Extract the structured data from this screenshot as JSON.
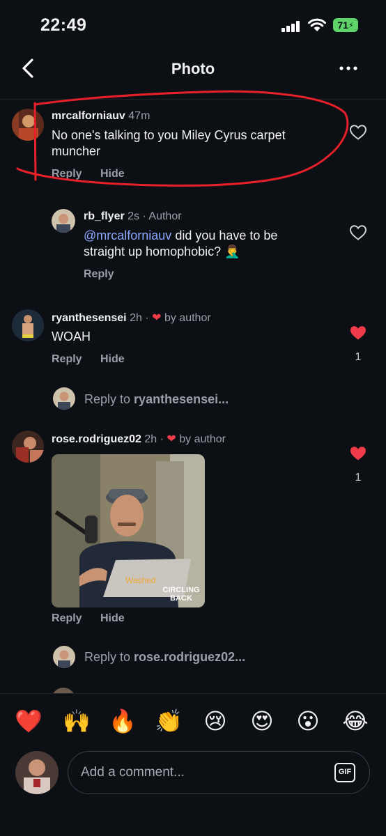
{
  "status_bar": {
    "time": "22:49",
    "battery": "71"
  },
  "nav": {
    "title": "Photo"
  },
  "comments": [
    {
      "username": "mrcalforniauv",
      "time": "47m",
      "text": "No one's talking to you Miley Cyrus carpet muncher",
      "reply_label": "Reply",
      "hide_label": "Hide"
    },
    {
      "username": "rb_flyer",
      "time": "2s",
      "author_tag": "· Author",
      "mention": "@mrcalforniauv",
      "text": " did you have to be straight up homophobic? 🤦‍♂️",
      "reply_label": "Reply"
    },
    {
      "username": "ryanthesensei",
      "time": "2h ·",
      "liked_by": "by author",
      "text": "WOAH",
      "reply_label": "Reply",
      "hide_label": "Hide",
      "like_count": "1",
      "reply_to_prefix": "Reply to ",
      "reply_to_user": "ryanthesensei..."
    },
    {
      "username": "rose.rodriguez02",
      "time": "2h ·",
      "liked_by": "by author",
      "gif_caption_line1": "CIRCLING",
      "gif_caption_line2": "BACK",
      "gif_laptop_text": "Washed",
      "reply_label": "Reply",
      "hide_label": "Hide",
      "like_count": "1",
      "reply_to_prefix": "Reply to ",
      "reply_to_user": "rose.rodriguez02..."
    }
  ],
  "reactions": [
    "❤️",
    "🙌",
    "🔥",
    "👏",
    "😢",
    "😍",
    "😮",
    "😂"
  ],
  "composer": {
    "placeholder": "Add a comment...",
    "gif_label": "GIF"
  },
  "colors": {
    "background": "#0c0f14",
    "heart": "#ef3b4a",
    "mention": "#8ea9ff",
    "annotation": "#e8202a"
  }
}
